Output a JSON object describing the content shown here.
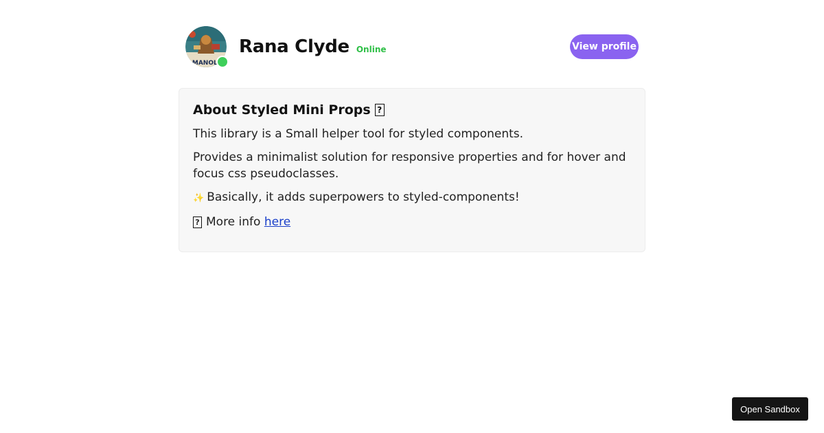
{
  "profile": {
    "name": "Rana Clyde",
    "status": "Online",
    "avatar_icon": "avatar-image",
    "status_color": "#3ecf5a",
    "view_profile_label": "View profile",
    "accent": "#8a63f0"
  },
  "about": {
    "title": "About Styled Mini Props",
    "title_icon": "missing-glyph-icon",
    "line1": "This library is a Small helper tool for styled components.",
    "line2": "Provides a minimalist solution for responsive properties and for hover and focus css pseudoclasses.",
    "line3_icon": "sparkles-icon",
    "line3": "Basically, it adds superpowers to styled-components!",
    "line4_icon": "missing-glyph-icon",
    "line4_prefix": "More info",
    "line4_link": "here"
  },
  "sandbox": {
    "label": "Open Sandbox"
  }
}
